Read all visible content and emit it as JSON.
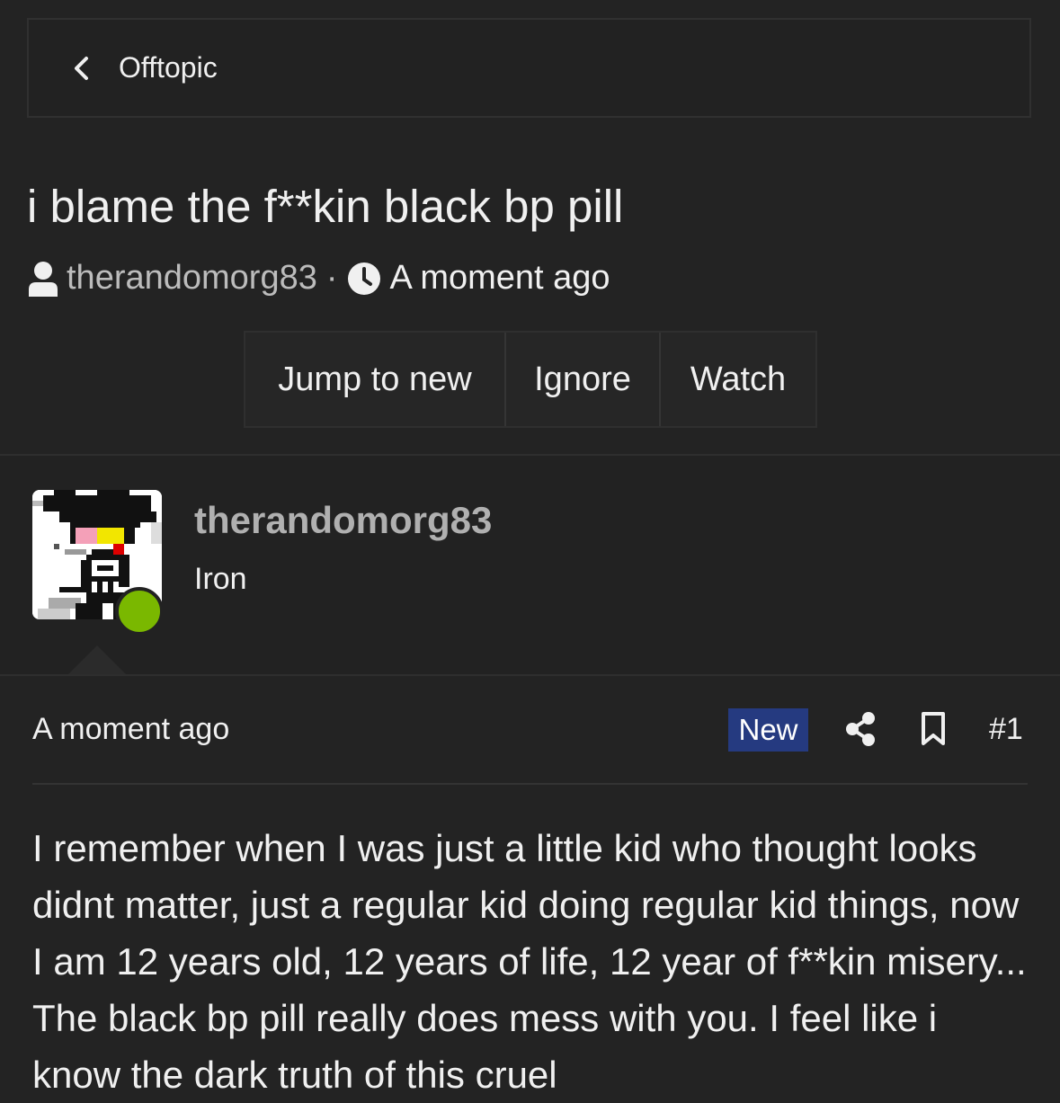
{
  "breadcrumb": {
    "label": "Offtopic"
  },
  "thread": {
    "title": "i blame the f**kin black bp pill",
    "author": "therandomorg83",
    "time": "A moment ago"
  },
  "actions": {
    "jump_to_new": "Jump to new",
    "ignore": "Ignore",
    "watch": "Watch"
  },
  "author_box": {
    "username": "therandomorg83",
    "rank": "Iron",
    "online": true,
    "online_color": "#7ab800"
  },
  "post": {
    "time": "A moment ago",
    "badge": "New",
    "badge_color": "#253a80",
    "number": "#1",
    "body": "I remember when I was just a little kid who thought looks didnt matter, just a regular kid doing regular kid things, now I am 12 years old, 12 years of life, 12 year of f**kin misery... The black bp pill really does mess with you. I feel like i know the dark truth of this cruel"
  },
  "icons": {
    "back": "chevron-left-icon",
    "user": "user-icon",
    "clock": "clock-icon",
    "share": "share-icon",
    "bookmark": "bookmark-icon"
  }
}
